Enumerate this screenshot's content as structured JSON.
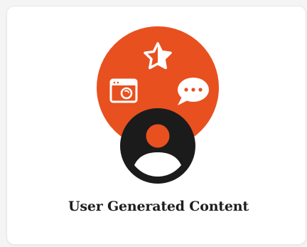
{
  "card": {
    "title": "User Generated Content"
  },
  "illustration": {
    "circle_color": "#e8501f",
    "avatar_color": "#1b1b1b",
    "icon_color": "#ffffff",
    "icons": [
      "star-icon",
      "browser-window-icon",
      "chat-bubble-icon",
      "user-avatar-icon"
    ]
  }
}
